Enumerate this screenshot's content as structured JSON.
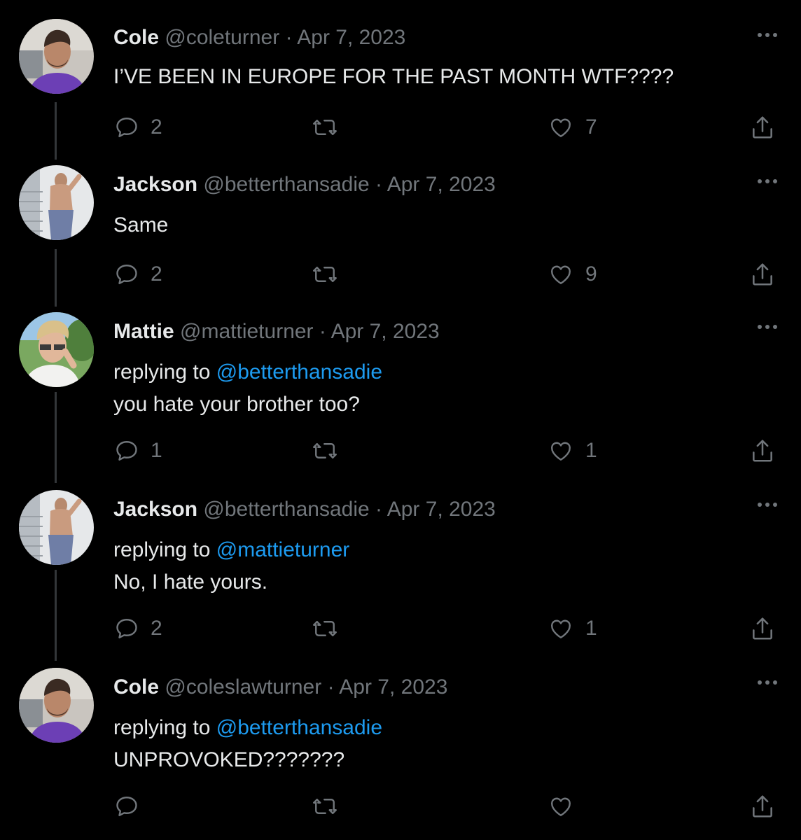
{
  "colors": {
    "background": "#000000",
    "text_primary": "#e7e9ea",
    "text_secondary": "#71767b",
    "mention": "#1d9bf0",
    "thread_line": "#333639"
  },
  "icons": {
    "reply": "speech-bubble-icon",
    "retweet": "retweet-arrows-icon",
    "like": "heart-outline-icon",
    "share": "share-upload-icon",
    "more": "three-dots-icon"
  },
  "tweets": [
    {
      "name": "Cole",
      "handle": "@coleturner",
      "separator": "·",
      "date": "Apr 7, 2023",
      "reply_prefix": "",
      "reply_to": "",
      "text": "I’VE BEEN IN EUROPE FOR THE PAST MONTH WTF????",
      "replies": "2",
      "likes": "7"
    },
    {
      "name": "Jackson",
      "handle": "@betterthansadie",
      "separator": "·",
      "date": "Apr 7, 2023",
      "reply_prefix": "",
      "reply_to": "",
      "text": "Same",
      "replies": "2",
      "likes": "9"
    },
    {
      "name": "Mattie",
      "handle": "@mattieturner",
      "separator": "·",
      "date": "Apr 7, 2023",
      "reply_prefix": "replying to ",
      "reply_to": "@betterthansadie",
      "text": "you hate your brother too?",
      "replies": "1",
      "likes": "1"
    },
    {
      "name": "Jackson",
      "handle": "@betterthansadie",
      "separator": "·",
      "date": "Apr 7, 2023",
      "reply_prefix": "replying to ",
      "reply_to": "@mattieturner",
      "text": "No, I hate yours.",
      "replies": "2",
      "likes": "1"
    },
    {
      "name": "Cole",
      "handle": "@coleslawturner",
      "separator": "·",
      "date": "Apr 7, 2023",
      "reply_prefix": "replying to ",
      "reply_to": "@betterthansadie",
      "text": "UNPROVOKED???????",
      "replies": "",
      "likes": ""
    }
  ]
}
